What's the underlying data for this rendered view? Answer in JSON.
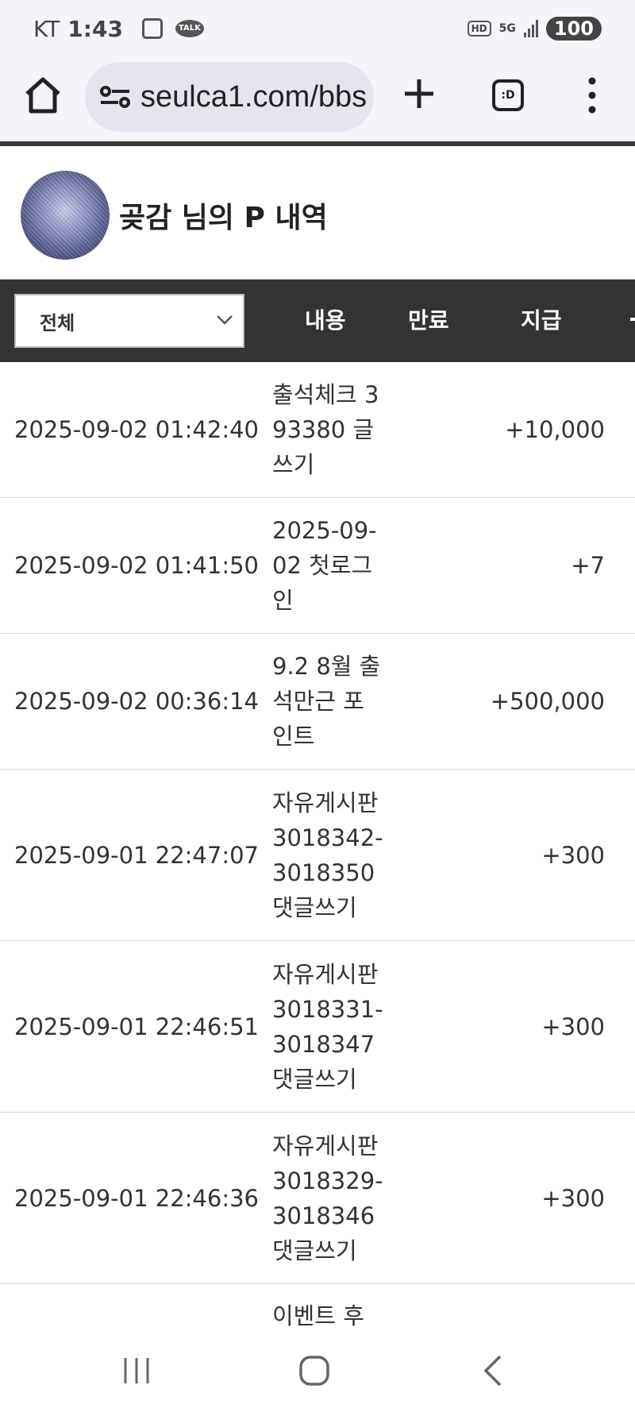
{
  "status_bar": {
    "carrier": "KT",
    "time": "1:43",
    "talk_badge": "TALK",
    "hd_badge": "HD",
    "network": "5G",
    "battery": "100"
  },
  "browser": {
    "url": "seulca1.com/bbs",
    "tabs_label": ":D"
  },
  "profile": {
    "title": "곶감 님의 P 내역"
  },
  "filter": {
    "selected": "전체",
    "columns": [
      "내용",
      "만료",
      "지급"
    ]
  },
  "rows": [
    {
      "date": "2025-09-02 01:42:40",
      "content": "출석체크 393380 글쓰기",
      "amount": "+10,000"
    },
    {
      "date": "2025-09-02 01:41:50",
      "content": "2025-09-02 첫로그인",
      "amount": "+7"
    },
    {
      "date": "2025-09-02 00:36:14",
      "content": "9.2 8월 출석만근 포인트",
      "amount": "+500,000"
    },
    {
      "date": "2025-09-01 22:47:07",
      "content": "자유게시판 3018342-3018350 댓글쓰기",
      "amount": "+300"
    },
    {
      "date": "2025-09-01 22:46:51",
      "content": "자유게시판 3018331-3018347 댓글쓰기",
      "amount": "+300"
    },
    {
      "date": "2025-09-01 22:46:36",
      "content": "자유게시판 3018329-3018346 댓글쓰기",
      "amount": "+300"
    },
    {
      "date": "",
      "content": "이벤트 후",
      "amount": ""
    }
  ]
}
